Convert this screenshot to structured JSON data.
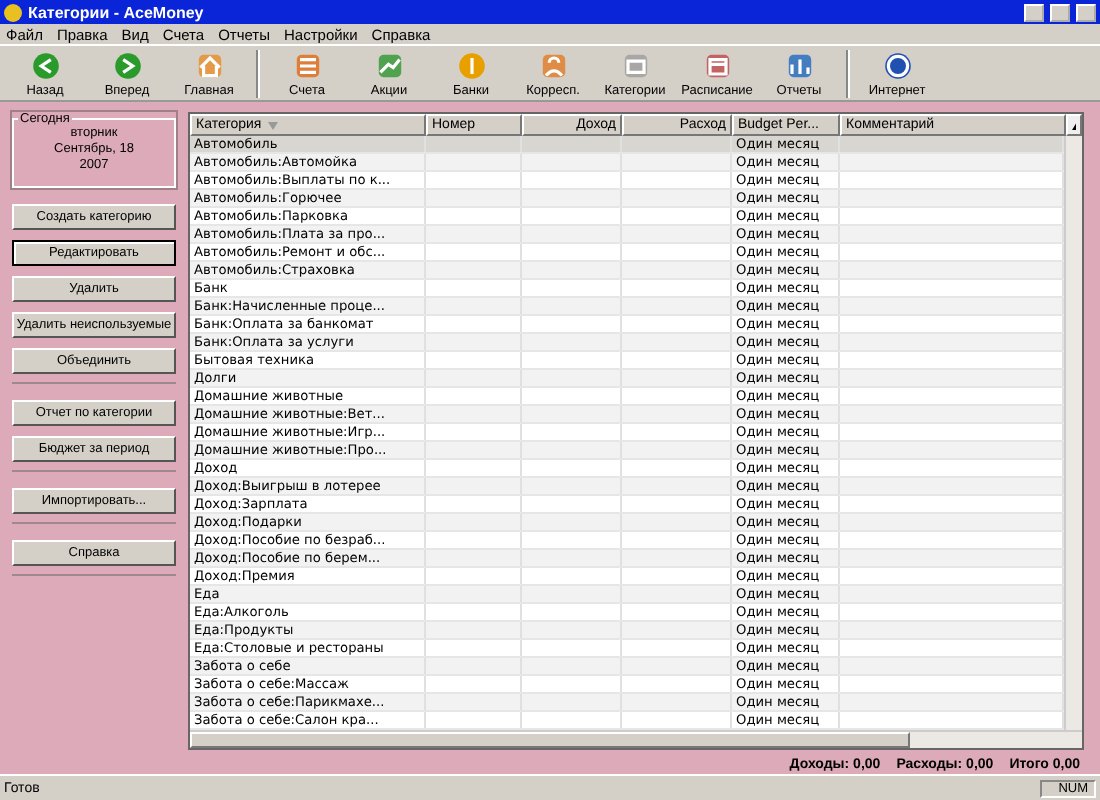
{
  "window": {
    "title": "Категории - AceMoney"
  },
  "menu": [
    "Файл",
    "Правка",
    "Вид",
    "Счета",
    "Отчеты",
    "Настройки",
    "Справка"
  ],
  "toolbar": [
    {
      "label": "Назад",
      "kind": "back"
    },
    {
      "label": "Вперед",
      "kind": "forward"
    },
    {
      "label": "Главная",
      "kind": "home",
      "separator_after": true
    },
    {
      "label": "Счета",
      "kind": "accounts"
    },
    {
      "label": "Акции",
      "kind": "stocks"
    },
    {
      "label": "Банки",
      "kind": "banks"
    },
    {
      "label": "Корресп.",
      "kind": "payees"
    },
    {
      "label": "Категории",
      "kind": "categories"
    },
    {
      "label": "Расписание",
      "kind": "schedule"
    },
    {
      "label": "Отчеты",
      "kind": "reports",
      "separator_after": true
    },
    {
      "label": "Интернет",
      "kind": "internet"
    }
  ],
  "today": {
    "legend": "Сегодня",
    "lines": [
      "вторник",
      "Сентябрь, 18",
      "2007"
    ]
  },
  "sidebar": {
    "groups": [
      [
        {
          "label": "Создать категорию",
          "focused": false
        },
        {
          "label": "Редактировать",
          "focused": true
        },
        {
          "label": "Удалить",
          "focused": false
        },
        {
          "label": "Удалить неиспользуемые",
          "focused": false
        },
        {
          "label": "Объединить",
          "focused": false
        }
      ],
      [
        {
          "label": "Отчет по категории",
          "focused": false
        },
        {
          "label": "Бюджет за период",
          "focused": false
        }
      ],
      [
        {
          "label": "Импортировать...",
          "focused": false
        }
      ],
      [
        {
          "label": "Справка",
          "focused": false
        }
      ]
    ]
  },
  "table": {
    "columns": [
      {
        "label": "Категория",
        "sorted": true,
        "kind": "text"
      },
      {
        "label": "Номер",
        "sorted": false,
        "kind": "text"
      },
      {
        "label": "Доход",
        "sorted": false,
        "kind": "amount"
      },
      {
        "label": "Расход",
        "sorted": false,
        "kind": "amount"
      },
      {
        "label": "Budget Per...",
        "sorted": false,
        "kind": "text"
      },
      {
        "label": "Комментарий",
        "sorted": false,
        "kind": "text"
      }
    ],
    "rows": [
      {
        "category": "Автомобиль",
        "budget_period": "Один месяц",
        "selected": true
      },
      {
        "category": "Автомобиль:Автомойка",
        "budget_period": "Один месяц",
        "selected": false
      },
      {
        "category": "Автомобиль:Выплаты по к...",
        "budget_period": "Один месяц",
        "selected": false
      },
      {
        "category": "Автомобиль:Горючее",
        "budget_period": "Один месяц",
        "selected": false
      },
      {
        "category": "Автомобиль:Парковка",
        "budget_period": "Один месяц",
        "selected": false
      },
      {
        "category": "Автомобиль:Плата за про...",
        "budget_period": "Один месяц",
        "selected": false
      },
      {
        "category": "Автомобиль:Ремонт и обс...",
        "budget_period": "Один месяц",
        "selected": false
      },
      {
        "category": "Автомобиль:Страховка",
        "budget_period": "Один месяц",
        "selected": false
      },
      {
        "category": "Банк",
        "budget_period": "Один месяц",
        "selected": false
      },
      {
        "category": "Банк:Начисленные проце...",
        "budget_period": "Один месяц",
        "selected": false
      },
      {
        "category": "Банк:Оплата за банкомат",
        "budget_period": "Один месяц",
        "selected": false
      },
      {
        "category": "Банк:Оплата за услуги",
        "budget_period": "Один месяц",
        "selected": false
      },
      {
        "category": "Бытовая техника",
        "budget_period": "Один месяц",
        "selected": false
      },
      {
        "category": "Долги",
        "budget_period": "Один месяц",
        "selected": false
      },
      {
        "category": "Домашние животные",
        "budget_period": "Один месяц",
        "selected": false
      },
      {
        "category": "Домашние животные:Вет...",
        "budget_period": "Один месяц",
        "selected": false
      },
      {
        "category": "Домашние животные:Игр...",
        "budget_period": "Один месяц",
        "selected": false
      },
      {
        "category": "Домашние животные:Про...",
        "budget_period": "Один месяц",
        "selected": false
      },
      {
        "category": "Доход",
        "budget_period": "Один месяц",
        "selected": false
      },
      {
        "category": "Доход:Выигрыш в лотерее",
        "budget_period": "Один месяц",
        "selected": false
      },
      {
        "category": "Доход:Зарплата",
        "budget_period": "Один месяц",
        "selected": false
      },
      {
        "category": "Доход:Подарки",
        "budget_period": "Один месяц",
        "selected": false
      },
      {
        "category": "Доход:Пособие по безраб...",
        "budget_period": "Один месяц",
        "selected": false
      },
      {
        "category": "Доход:Пособие по берем...",
        "budget_period": "Один месяц",
        "selected": false
      },
      {
        "category": "Доход:Премия",
        "budget_period": "Один месяц",
        "selected": false
      },
      {
        "category": "Еда",
        "budget_period": "Один месяц",
        "selected": false
      },
      {
        "category": "Еда:Алкоголь",
        "budget_period": "Один месяц",
        "selected": false
      },
      {
        "category": "Еда:Продукты",
        "budget_period": "Один месяц",
        "selected": false
      },
      {
        "category": "Еда:Столовые и рестораны",
        "budget_period": "Один месяц",
        "selected": false
      },
      {
        "category": "Забота о себе",
        "budget_period": "Один месяц",
        "selected": false
      },
      {
        "category": "Забота о себе:Массаж",
        "budget_period": "Один месяц",
        "selected": false
      },
      {
        "category": "Забота о себе:Парикмахе...",
        "budget_period": "Один месяц",
        "selected": false
      },
      {
        "category": "Забота о себе:Салон кра...",
        "budget_period": "Один месяц",
        "selected": false
      }
    ]
  },
  "totals": [
    "Доходы: 0,00",
    "Расходы: 0,00",
    "Итого 0,00"
  ],
  "status_bar": {
    "text": "Готов",
    "indicator": "NUM"
  }
}
